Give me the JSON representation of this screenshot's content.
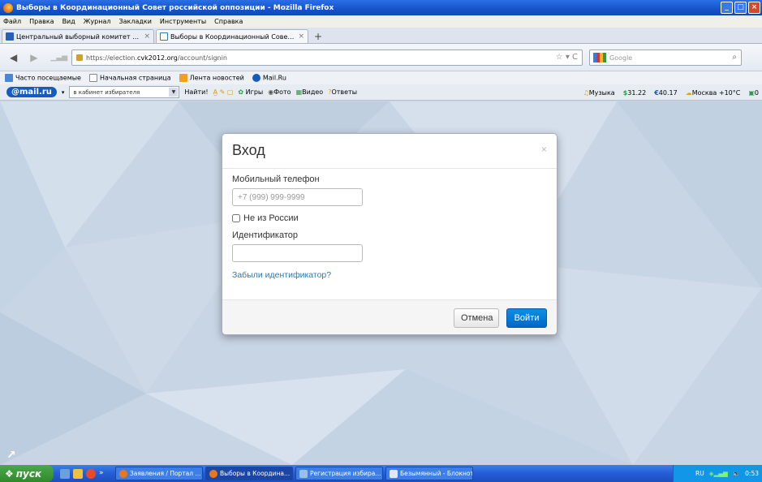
{
  "window": {
    "title": "Выборы в Координационный Совет российской оппозиции - Mozilla Firefox"
  },
  "menu": [
    "Файл",
    "Правка",
    "Вид",
    "Журнал",
    "Закладки",
    "Инструменты",
    "Справка"
  ],
  "tabs": [
    {
      "label": "Центральный выборный комитет выб...",
      "active": false
    },
    {
      "label": "Выборы в Координационный Совет ро...",
      "active": true
    }
  ],
  "nav": {
    "url_host": "https://election.",
    "url_domain": "cvk2012.org",
    "url_path": "/account/signin",
    "search_placeholder": "Google"
  },
  "bookmarks": [
    "Часто посещаемые",
    "Начальная страница",
    "Лента новостей",
    "Mail.Ru"
  ],
  "mailbar": {
    "logo": "@mail.ru",
    "search_value": "в кабинет избирателя",
    "find_label": "Найти!",
    "links": [
      "Игры",
      "Фото",
      "Видео",
      "Ответы"
    ],
    "music": "Музыка",
    "usd": "31.22",
    "eur": "40.17",
    "weather": "Москва +10°C",
    "count": "0"
  },
  "modal": {
    "title": "Вход",
    "close": "×",
    "phone_label": "Мобильный телефон",
    "phone_placeholder": "+7 (999) 999-9999",
    "not_russia_label": "Не из России",
    "id_label": "Идентификатор",
    "forgot_link": "Забыли идентификатор?",
    "cancel": "Отмена",
    "submit": "Войти"
  },
  "taskbar": {
    "start": "пуск",
    "tasks": [
      {
        "label": "Заявления / Портал ...",
        "active": false
      },
      {
        "label": "Выборы в Координа...",
        "active": true
      },
      {
        "label": "Регистрация избира...",
        "active": false
      },
      {
        "label": "Безымянный - Блокнот",
        "active": false
      }
    ],
    "lang": "RU",
    "time": "0:53"
  },
  "colors": {
    "accent": "#0068c8",
    "link": "#2a7ab8",
    "taskbar": "#245dd6"
  }
}
